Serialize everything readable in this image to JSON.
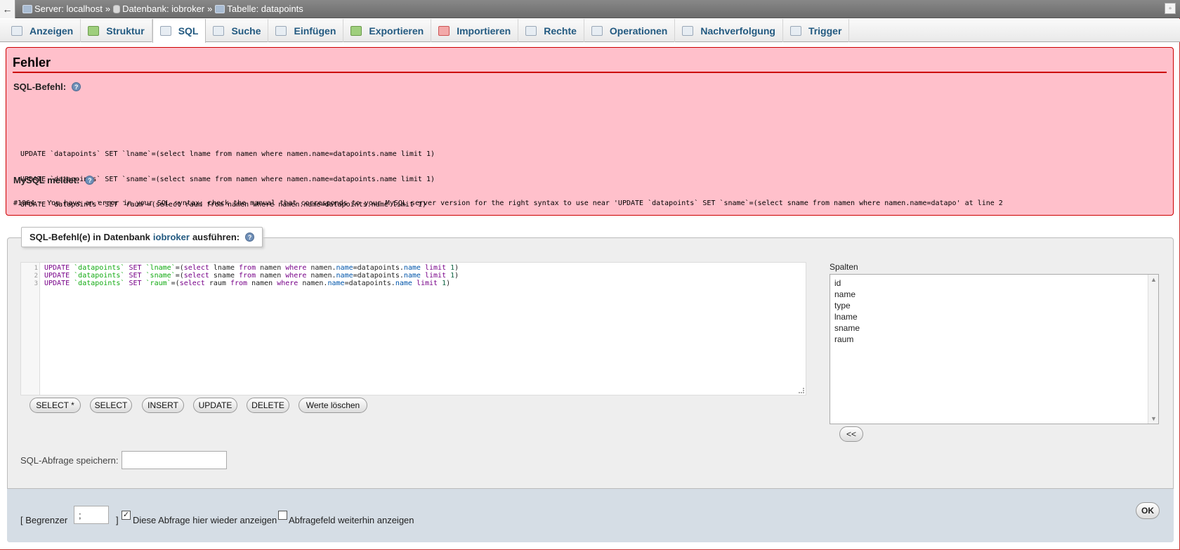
{
  "breadcrumb": {
    "collapse_glyph": "←",
    "server": "Server: localhost",
    "database": "Datenbank: iobroker",
    "table": "Tabelle: datapoints",
    "separator": "»",
    "corner_glyph": "▫"
  },
  "tabs": [
    {
      "label": "Anzeigen",
      "icon": "browse-icon"
    },
    {
      "label": "Struktur",
      "icon": "structure-icon"
    },
    {
      "label": "SQL",
      "icon": "sql-icon",
      "active": true
    },
    {
      "label": "Suche",
      "icon": "search-icon"
    },
    {
      "label": "Einfügen",
      "icon": "insert-icon"
    },
    {
      "label": "Exportieren",
      "icon": "export-icon"
    },
    {
      "label": "Importieren",
      "icon": "import-icon"
    },
    {
      "label": "Rechte",
      "icon": "privileges-icon"
    },
    {
      "label": "Operationen",
      "icon": "operations-icon"
    },
    {
      "label": "Nachverfolgung",
      "icon": "tracking-icon"
    },
    {
      "label": "Trigger",
      "icon": "trigger-icon"
    }
  ],
  "error": {
    "title": "Fehler",
    "sql_label": "SQL-Befehl:",
    "sql_lines": [
      "UPDATE `datapoints` SET `lname`=(select lname from namen where namen.name=datapoints.name limit 1)",
      "UPDATE `datapoints` SET `sname`=(select sname from namen where namen.name=datapoints.name limit 1)",
      "UPDATE `datapoints` SET `raum`=(select raum from namen where namen.name=datapoints.name limit 1)"
    ],
    "mysql_label": "MySQL meldet:",
    "message": "#1064 - You have an error in your SQL syntax; check the manual that corresponds to your MySQL server version for the right syntax to use near 'UPDATE `datapoints` SET `sname`=(select sname from namen where namen.name=datapo' at line 2"
  },
  "query_box": {
    "legend_prefix": "SQL-Befehl(e) in Datenbank",
    "db_name": "iobroker",
    "legend_suffix": "ausführen:",
    "line_numbers": [
      "1",
      "2",
      "3"
    ],
    "buttons": [
      "SELECT *",
      "SELECT",
      "INSERT",
      "UPDATE",
      "DELETE",
      "Werte löschen"
    ],
    "columns_label": "Spalten",
    "columns": [
      "id",
      "name",
      "type",
      "lname",
      "sname",
      "raum"
    ],
    "insert_column_button": "<<",
    "save_label": "SQL-Abfrage speichern:",
    "save_value": ""
  },
  "footer": {
    "delimiter_prefix": "[ Begrenzer",
    "delimiter_value": ";",
    "delimiter_suffix": "]",
    "show_query_label": "Diese Abfrage hier wieder anzeigen",
    "show_query_checked": true,
    "retain_box_label": "Abfragefeld weiterhin anzeigen",
    "retain_box_checked": false,
    "ok_label": "OK"
  },
  "colors": {
    "error_bg": "#ffc0cb",
    "error_border": "#cc0000",
    "link_blue": "#235a81"
  }
}
